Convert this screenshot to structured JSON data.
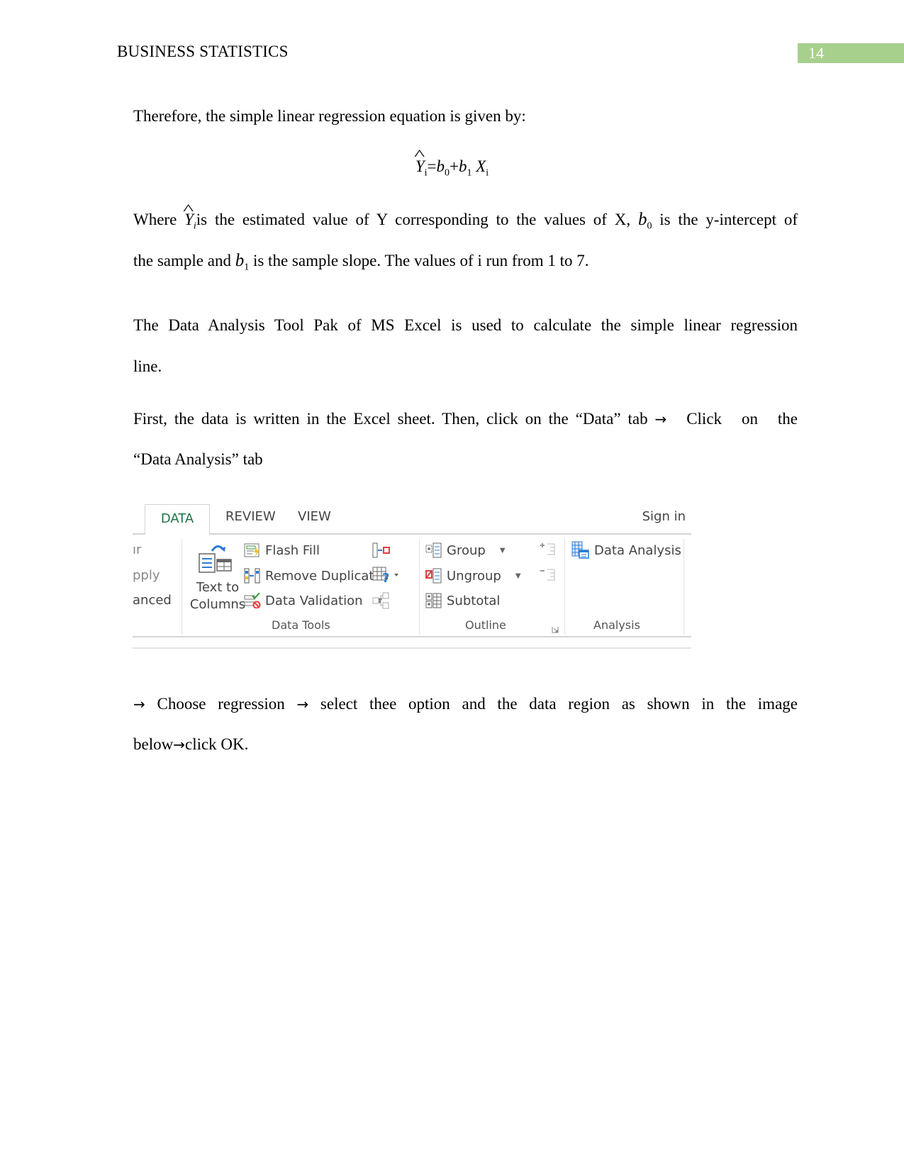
{
  "header": {
    "title": "BUSINESS STATISTICS",
    "page_number": "14",
    "accent_color": "#a8d08d"
  },
  "body": {
    "intro": "Therefore, the simple linear regression equation is given by:",
    "equation": {
      "lhs": "Y",
      "lhs_sub": "i",
      "equals": "=",
      "b0": "b",
      "b0_sub": "0",
      "plus": "+",
      "b1": "b",
      "b1_sub": "1",
      "x": "X",
      "x_sub": "i"
    },
    "where_1a": "Where ",
    "where_1b": "is the estimated value of Y corresponding to the values of X, ",
    "where_1c": " is the y-intercept of",
    "where_2a": "the sample and ",
    "where_2b": " is the sample slope. The values of i run from 1 to 7.",
    "toolpak_1": "The Data Analysis Tool Pak of MS Excel is used to calculate the simple linear regression",
    "toolpak_2": "line.",
    "first_1a": "First, the data is written in the Excel sheet. Then, click on the “Data” tab ",
    "first_1b": " Click on the",
    "first_2": "“Data Analysis” tab",
    "choose_1a": " Choose regression ",
    "choose_1b": " select thee option and the data region as shown in the image",
    "choose_2a": "below",
    "choose_2b": "click OK.",
    "arrow": "→"
  },
  "ribbon": {
    "tabs": [
      {
        "label": "DATA",
        "active": true
      },
      {
        "label": "REVIEW",
        "active": false
      },
      {
        "label": "VIEW",
        "active": false
      }
    ],
    "sign_in": "Sign in",
    "cut_off_items": [
      "ır",
      "pply",
      "anced"
    ],
    "data_tools": {
      "label": "Data Tools",
      "text_to_columns_1": "Text to",
      "text_to_columns_2": "Columns",
      "flash_fill": "Flash Fill",
      "remove_duplicates": "Remove Duplicates",
      "data_validation": "Data Validation"
    },
    "outline": {
      "label": "Outline",
      "group": "Group",
      "ungroup": "Ungroup",
      "subtotal": "Subtotal"
    },
    "analysis": {
      "label": "Analysis",
      "data_analysis": "Data Analysis"
    },
    "dropdown_glyph": "▼"
  }
}
